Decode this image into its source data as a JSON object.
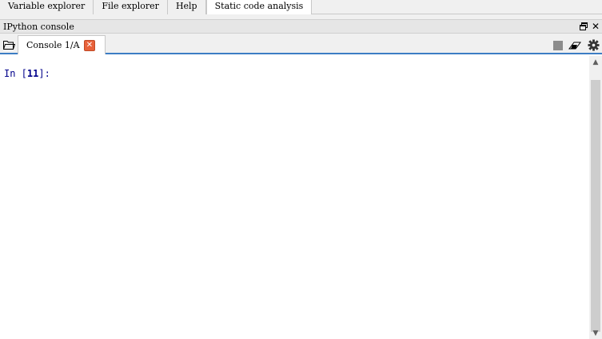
{
  "top_tabs": [
    {
      "label": "Variable explorer",
      "active": false
    },
    {
      "label": "File explorer",
      "active": false
    },
    {
      "label": "Help",
      "active": false
    },
    {
      "label": "Static code analysis",
      "active": true
    }
  ],
  "pane": {
    "title": "IPython console",
    "close_glyph": "✕"
  },
  "console_tab": {
    "label": "Console 1/A",
    "close_glyph": "✕"
  },
  "console": {
    "prompt_prefix": "In [",
    "prompt_number": "11",
    "prompt_suffix": "]:"
  },
  "scrollbar": {
    "up_glyph": "▲",
    "down_glyph": "▼"
  },
  "icons": [
    "undock-icon",
    "close-icon",
    "folder-icon",
    "stop-icon",
    "eraser-icon",
    "gear-icon"
  ],
  "colors": {
    "accent": "#3c7dc4",
    "tab_close": "#e8613a",
    "prompt": "#00008b"
  }
}
